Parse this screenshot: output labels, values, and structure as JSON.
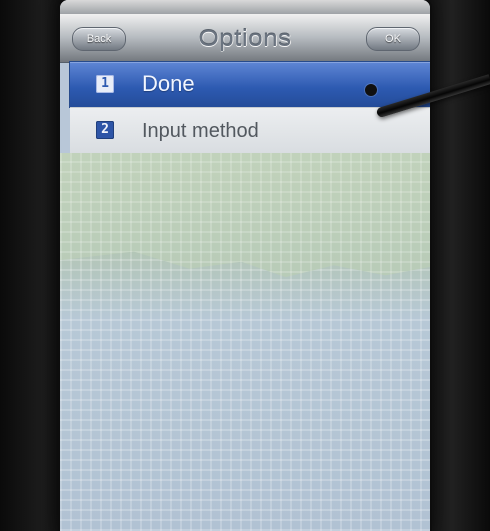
{
  "titlebar": {
    "back_label": "Back",
    "title": "Options",
    "ok_label": "OK"
  },
  "options": [
    {
      "number": "1",
      "label": "Done"
    },
    {
      "number": "2",
      "label": "Input method"
    }
  ]
}
